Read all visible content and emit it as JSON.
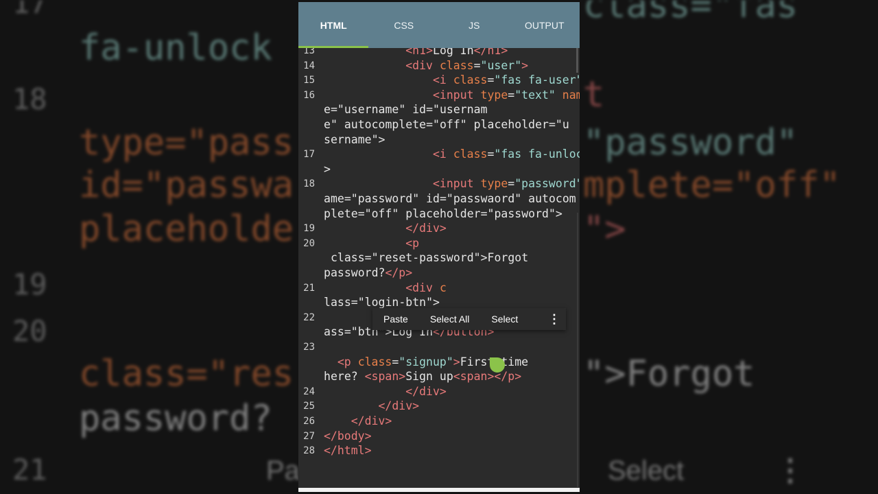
{
  "tabs": [
    {
      "label": "HTML"
    },
    {
      "label": "CSS"
    },
    {
      "label": "JS"
    },
    {
      "label": "OUTPUT"
    }
  ],
  "active_tab": "HTML",
  "colors": {
    "tabbar": "#5f7f8e",
    "tab_indicator": "#8bc34a",
    "editor_bg": "#2b2b2b",
    "attribute": "#e8804a",
    "string": "#9fd8d0",
    "tag": "#e87a7a",
    "text": "#e6e6e6",
    "selection_handle": "#8bc34a"
  },
  "code_lines": [
    {
      "num": "13",
      "text": "            <h1>Log In</h1>"
    },
    {
      "num": "14",
      "text": "            <div class=\"user\">"
    },
    {
      "num": "15",
      "text": "                <i class=\"fas fa-user\"></i>"
    },
    {
      "num": "16",
      "text": "                <input type=\"text\" name=\"username\" id=\"username\" autocomplete=\"off\" placeholder=\"username\">"
    },
    {
      "num": "17",
      "text": "                <i class=\"fas fa-unlock-alt\"></i>"
    },
    {
      "num": "18",
      "text": "                <input type=\"password\" name=\"password\" id=\"passwaord\" autocomplete=\"off\" placeholder=\"password\">"
    },
    {
      "num": "19",
      "text": "            </div>"
    },
    {
      "num": "20",
      "text": "            <p class=\"reset-password\">Forgot password?</p>"
    },
    {
      "num": "21",
      "text": "            <div class=\"login-btn\">"
    },
    {
      "num": "22",
      "text": "                <button class=\"btn\">Log In</button>"
    },
    {
      "num": "23",
      "text": "                <p class=\"signup\">First time here? <span>Sign up<span></p>"
    },
    {
      "num": "24",
      "text": "            </div>"
    },
    {
      "num": "25",
      "text": "        </div>"
    },
    {
      "num": "26",
      "text": "    </div>"
    },
    {
      "num": "27",
      "text": "</body>"
    },
    {
      "num": "28",
      "text": "</html>"
    }
  ],
  "context_menu": {
    "paste": "Paste",
    "select_all": "Select All",
    "select": "Select",
    "more_icon": "more-vertical-icon"
  },
  "background": {
    "line_numbers": [
      "17",
      "18",
      "19",
      "20",
      "21"
    ],
    "fragments": [
      "fa-unlock",
      "type=\"pass",
      "id=\"passwa",
      "placeholde",
      "class=\"res",
      "password?",
      "class=\"fas",
      "t",
      "\"password\"",
      "mplete=\"off\"",
      "\">",
      "\">Forgot",
      "Pa",
      "Select"
    ]
  }
}
